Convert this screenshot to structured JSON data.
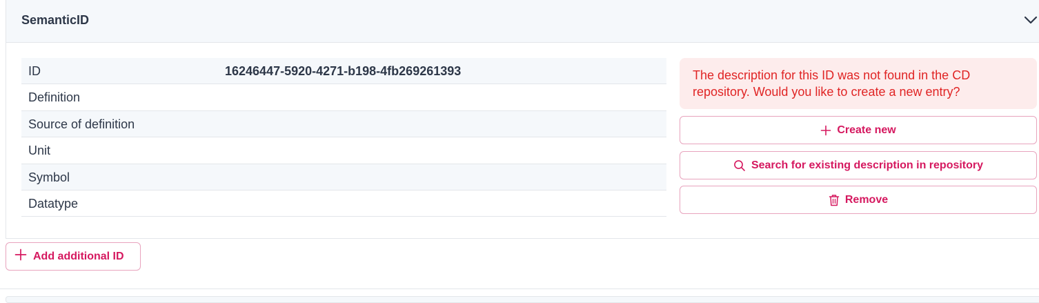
{
  "panel": {
    "title": "SemanticID",
    "toggle_icon": "chevron-down-icon"
  },
  "properties": [
    {
      "label": "ID",
      "value": "16246447-5920-4271-b198-4fb269261393"
    },
    {
      "label": "Definition",
      "value": ""
    },
    {
      "label": "Source of definition",
      "value": ""
    },
    {
      "label": "Unit",
      "value": ""
    },
    {
      "label": "Symbol",
      "value": ""
    },
    {
      "label": "Datatype",
      "value": ""
    }
  ],
  "alert": {
    "message": "The description for this ID was not found in the CD repository. Would you like to create a new entry?"
  },
  "actions": {
    "create_new": {
      "label": "Create new",
      "icon": "plus-icon"
    },
    "search_existing": {
      "label": "Search for existing description in repository",
      "icon": "search-icon"
    },
    "remove": {
      "label": "Remove",
      "icon": "trash-icon"
    }
  },
  "add_additional": {
    "label": "Add additional ID",
    "icon": "plus-icon"
  },
  "colors": {
    "accent": "#d5185f",
    "accent_border": "#e8a3bd",
    "alert_bg": "#fdecec",
    "alert_text": "#e02424",
    "header_bg": "#f5f8fb",
    "row_alt_bg": "#f5f8fb",
    "border": "#e3e6ea"
  }
}
